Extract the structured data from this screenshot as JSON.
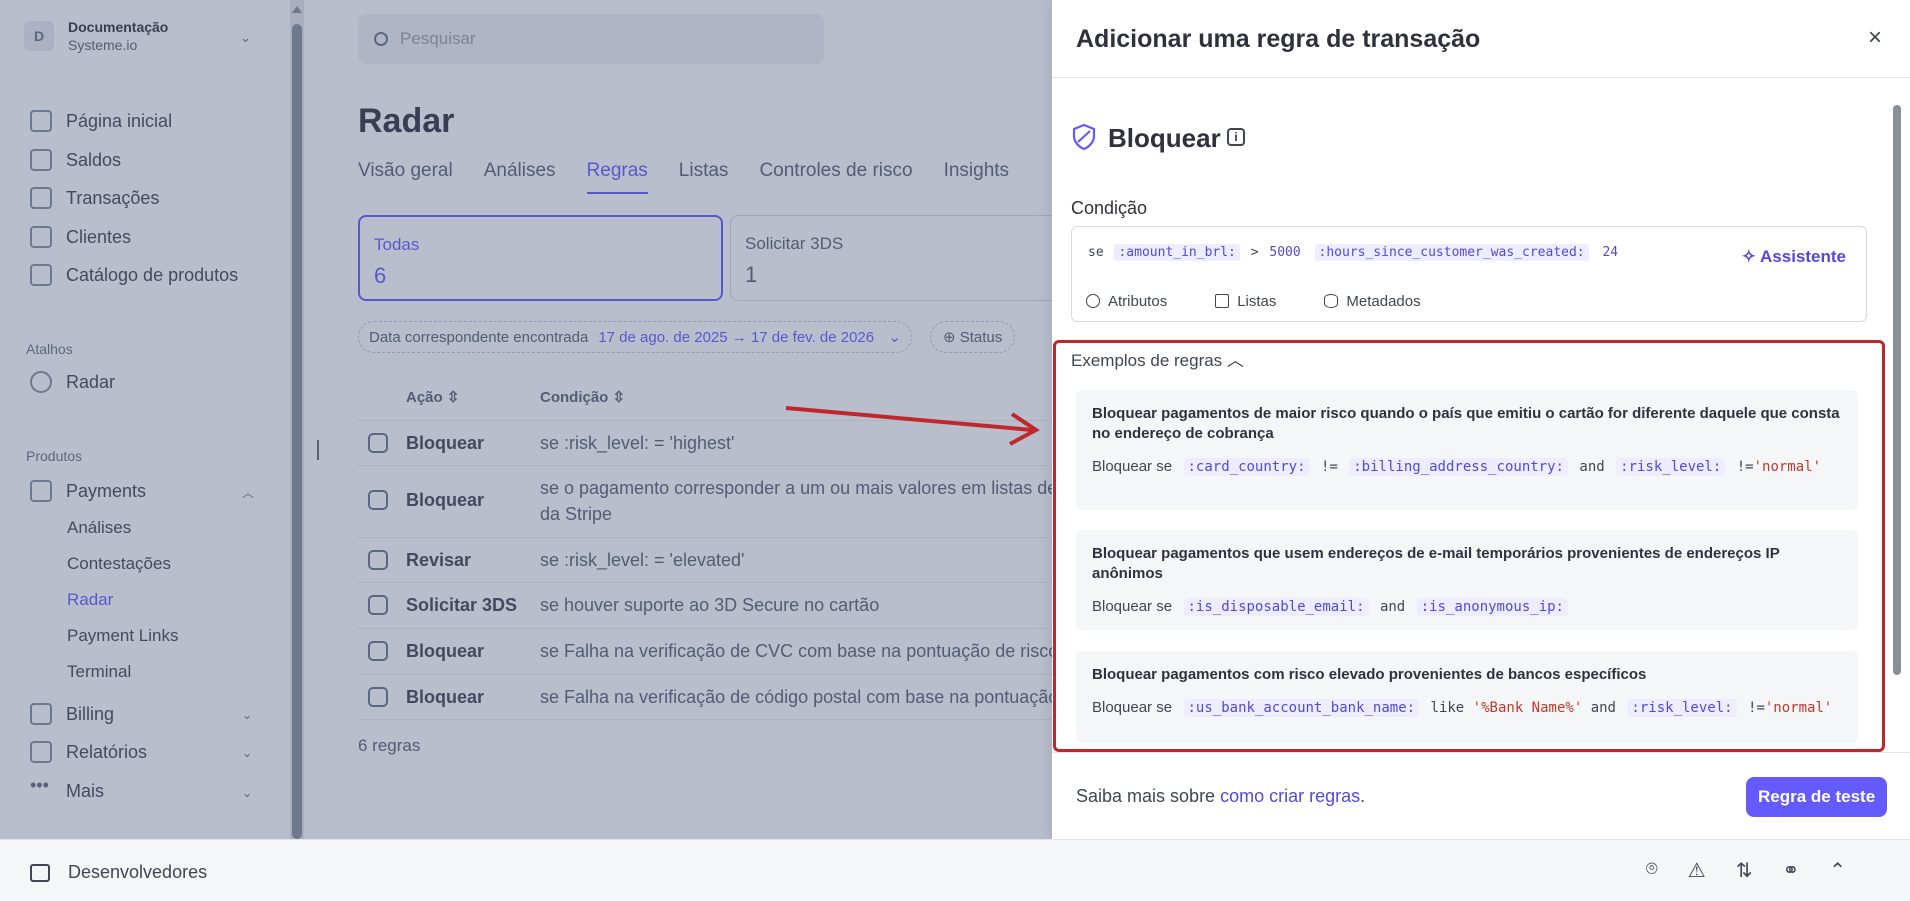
{
  "account": {
    "avatar": "D",
    "name": "Documentação",
    "sub": "Systeme.io"
  },
  "nav": {
    "home": "Página inicial",
    "balances": "Saldos",
    "transactions": "Transações",
    "customers": "Clientes",
    "catalog": "Catálogo de produtos",
    "shortcuts_head": "Atalhos",
    "radar": "Radar",
    "products_head": "Produtos",
    "payments": "Payments",
    "payments_sub": [
      "Análises",
      "Contestações",
      "Radar",
      "Payment Links",
      "Terminal"
    ],
    "billing": "Billing",
    "reports": "Relatórios",
    "more": "Mais"
  },
  "search": {
    "placeholder": "Pesquisar"
  },
  "page": {
    "title": "Radar",
    "tabs": [
      "Visão geral",
      "Análises",
      "Regras",
      "Listas",
      "Controles de risco",
      "Insights"
    ],
    "cards": [
      {
        "label": "Todas",
        "value": "6"
      },
      {
        "label": "Solicitar 3DS",
        "value": "1"
      }
    ],
    "filter_label": "Data correspondente encontrada",
    "filter_value": "17 de ago. de 2025 → 17 de fev. de 2026",
    "status_filter": "Status",
    "columns": [
      "Ação",
      "Condição"
    ],
    "rows": [
      {
        "action": "Bloquear",
        "condition": "se :risk_level: = 'highest'"
      },
      {
        "action": "Bloquear",
        "condition": "se o pagamento corresponder a um ou mais valores em listas de",
        "condition2": "da Stripe"
      },
      {
        "action": "Revisar",
        "condition": "se :risk_level: = 'elevated'"
      },
      {
        "action": "Solicitar 3DS",
        "condition": "se houver suporte ao 3D Secure no cartão"
      },
      {
        "action": "Bloquear",
        "condition": "se Falha na verificação de CVC com base na pontuação de risco"
      },
      {
        "action": "Bloquear",
        "condition": "se Falha na verificação de código postal com base na pontuação"
      }
    ],
    "count": "6 regras"
  },
  "bottombar": {
    "dev": "Desenvolvedores"
  },
  "drawer": {
    "title": "Adicionar uma regra de transação",
    "close": "×",
    "block_title": "Bloquear",
    "condition_label": "Condição",
    "condition": {
      "if": "se",
      "attr1": ":amount_in_brl:",
      "op": ">",
      "val1": "5000",
      "attr2": ":hours_since_customer_was_created:",
      "val2": "24"
    },
    "assistant": "Assistente",
    "links": [
      "Atributos",
      "Listas",
      "Metadados"
    ],
    "examples_head": "Exemplos de regras",
    "examples": [
      {
        "title": "Bloquear pagamentos de maior risco quando o país que emitiu o cartão for diferente daquele que consta no endereço de cobrança",
        "prefix": "Bloquear se",
        "a1": ":card_country:",
        "o1": "!=",
        "a2": ":billing_address_country:",
        "k1": "and",
        "a3": ":risk_level:",
        "o2": "!=",
        "s1": "'normal'"
      },
      {
        "title": "Bloquear pagamentos que usem endereços de e-mail temporários provenientes de endereços IP anônimos",
        "prefix": "Bloquear se",
        "a1": ":is_disposable_email:",
        "k1": "and",
        "a2": ":is_anonymous_ip:"
      },
      {
        "title": "Bloquear pagamentos com risco elevado provenientes de bancos específicos",
        "prefix": "Bloquear se",
        "a1": ":us_bank_account_bank_name:",
        "o1": "like",
        "s1": "'%Bank Name%'",
        "k1": "and",
        "a2": ":risk_level:",
        "o2": "!=",
        "s2": "'normal'"
      }
    ],
    "learn_prefix": "Saiba mais sobre",
    "learn_link": "como criar regras",
    "learn_suffix": ".",
    "test_button": "Regra de teste"
  },
  "colors": {
    "accent": "#635bff",
    "highlight": "#c0272d"
  }
}
